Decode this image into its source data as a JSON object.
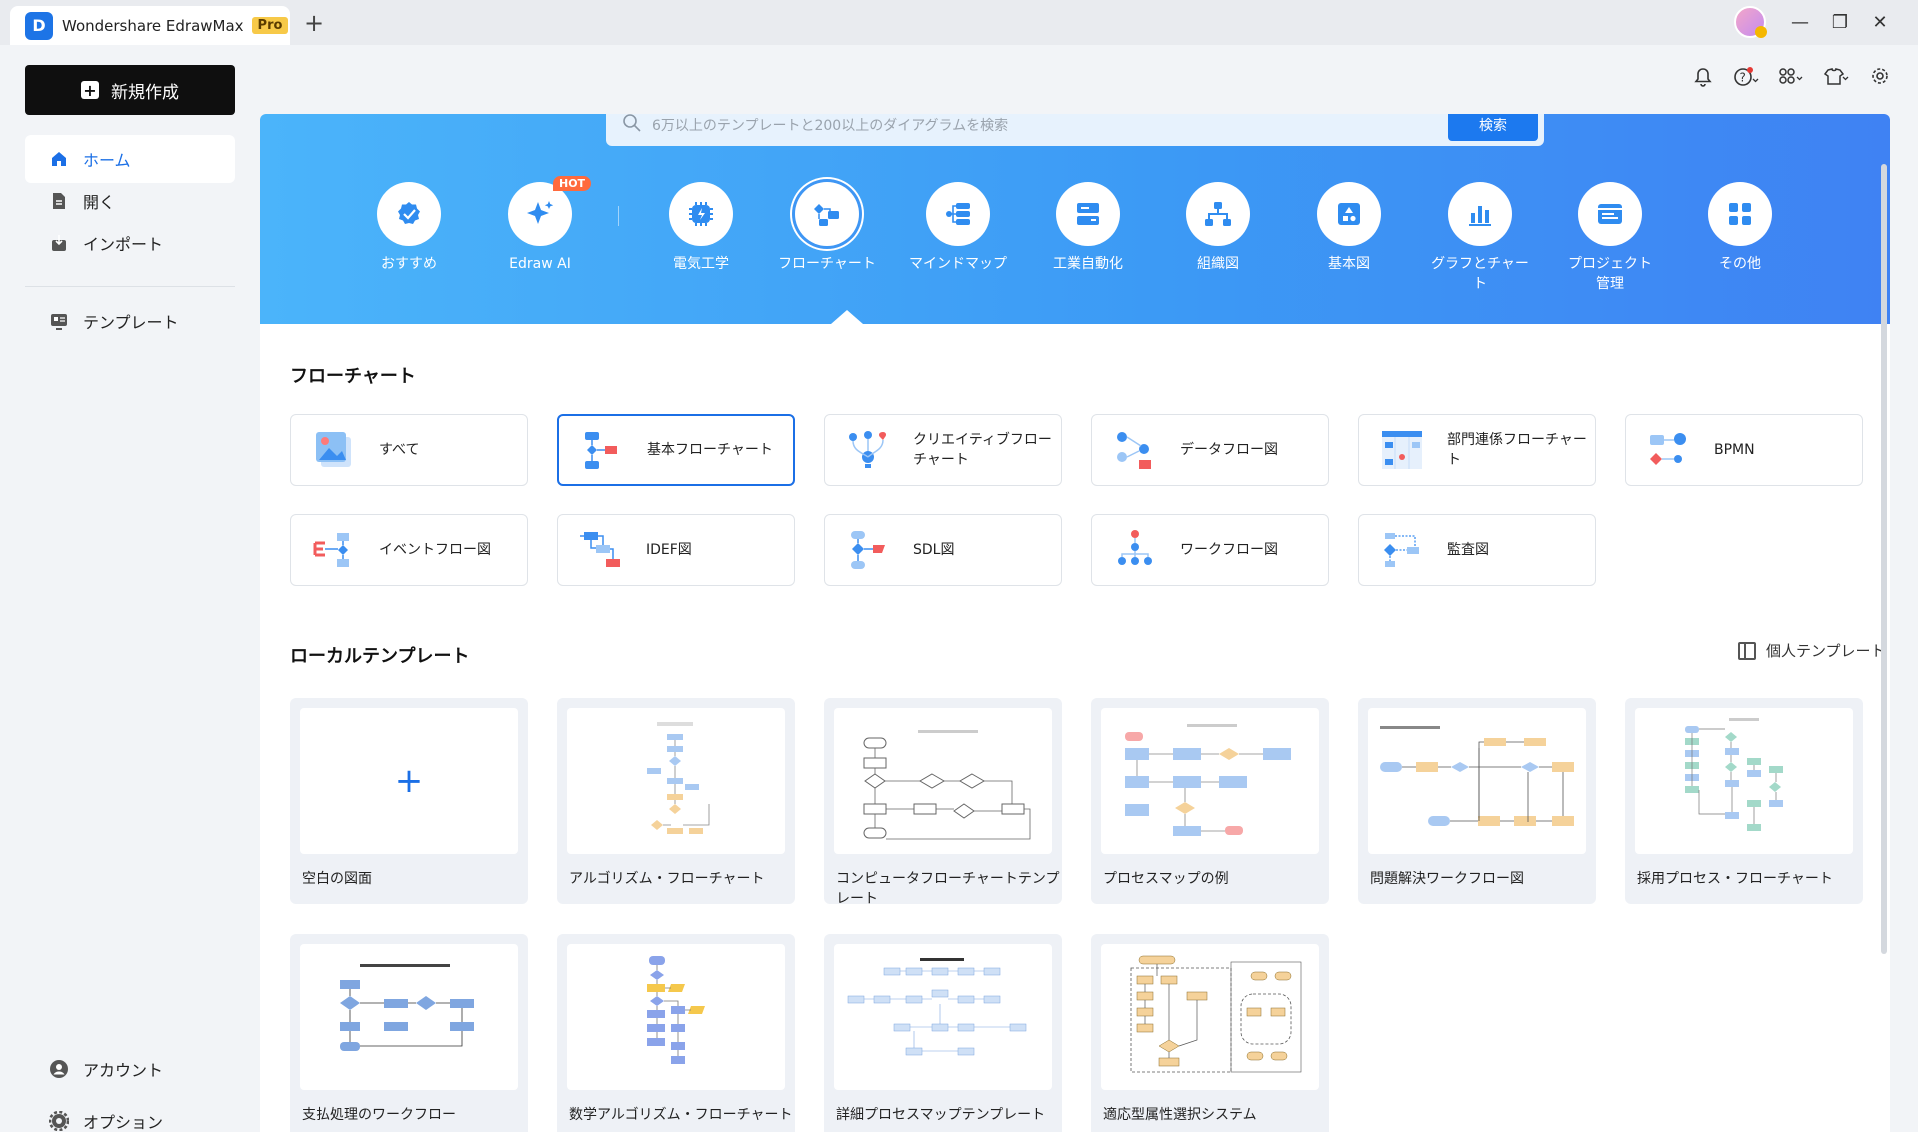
{
  "app": {
    "title": "Wondershare EdrawMax",
    "badge": "Pro",
    "new_tab": "+"
  },
  "window": {
    "minimize": "—",
    "restore": "❐",
    "close": "✕"
  },
  "sidebar": {
    "new_button": "新規作成",
    "items": [
      {
        "label": "ホーム",
        "icon": "home-icon"
      },
      {
        "label": "開く",
        "icon": "file-icon"
      },
      {
        "label": "インポート",
        "icon": "import-icon"
      },
      {
        "label": "テンプレート",
        "icon": "template-icon"
      }
    ],
    "bottom": [
      {
        "label": "アカウント",
        "icon": "account-icon"
      },
      {
        "label": "オプション",
        "icon": "gear-icon"
      }
    ]
  },
  "search": {
    "placeholder": "6万以上のテンプレートと200以上のダイアグラムを検索",
    "button": "検索"
  },
  "categories": [
    {
      "label": "おすすめ",
      "icon": "recommend-icon"
    },
    {
      "label": "Edraw AI",
      "icon": "ai-sparkle-icon",
      "badge": "HOT"
    },
    {
      "label": "電気工学",
      "icon": "electrical-icon"
    },
    {
      "label": "フローチャート",
      "icon": "flowchart-icon",
      "selected": true
    },
    {
      "label": "マインドマップ",
      "icon": "mindmap-icon"
    },
    {
      "label": "工業自動化",
      "icon": "automation-icon"
    },
    {
      "label": "組織図",
      "icon": "orgchart-icon"
    },
    {
      "label": "基本図",
      "icon": "basic-diagram-icon"
    },
    {
      "label": "グラフとチャー\nト",
      "icon": "graph-chart-icon"
    },
    {
      "label": "プロジェクト\n管理",
      "icon": "project-icon"
    },
    {
      "label": "その他",
      "icon": "more-grid-icon"
    }
  ],
  "flowchart_section": {
    "title": "フローチャート",
    "types": [
      {
        "label": "すべて"
      },
      {
        "label": "基本フローチャート",
        "selected": true
      },
      {
        "label": "クリエイティブフロー\nチャート"
      },
      {
        "label": "データフロー図"
      },
      {
        "label": "部門連係フローチャー\nト"
      },
      {
        "label": "BPMN"
      },
      {
        "label": "イベントフロー図"
      },
      {
        "label": "IDEF図"
      },
      {
        "label": "SDL図"
      },
      {
        "label": "ワークフロー図"
      },
      {
        "label": "監査図"
      }
    ]
  },
  "local_section": {
    "title": "ローカルテンプレート",
    "personal": "個人テンプレート",
    "templates": [
      {
        "name": "空白の図面",
        "blank": true
      },
      {
        "name": "アルゴリズム・フローチャート"
      },
      {
        "name": "コンピュータフローチャートテンプレート"
      },
      {
        "name": "プロセスマップの例"
      },
      {
        "name": "問題解決ワークフロー図"
      },
      {
        "name": "採用プロセス・フローチャート"
      },
      {
        "name": "支払処理のワークフロー"
      },
      {
        "name": "数学アルゴリズム・フローチャート"
      },
      {
        "name": "詳細プロセスマップテンプレート"
      },
      {
        "name": "適応型属性選択システム"
      }
    ]
  },
  "colors": {
    "accent": "#1b6fe6",
    "hero_start": "#4bb4fa",
    "hero_end": "#3f82f3"
  }
}
